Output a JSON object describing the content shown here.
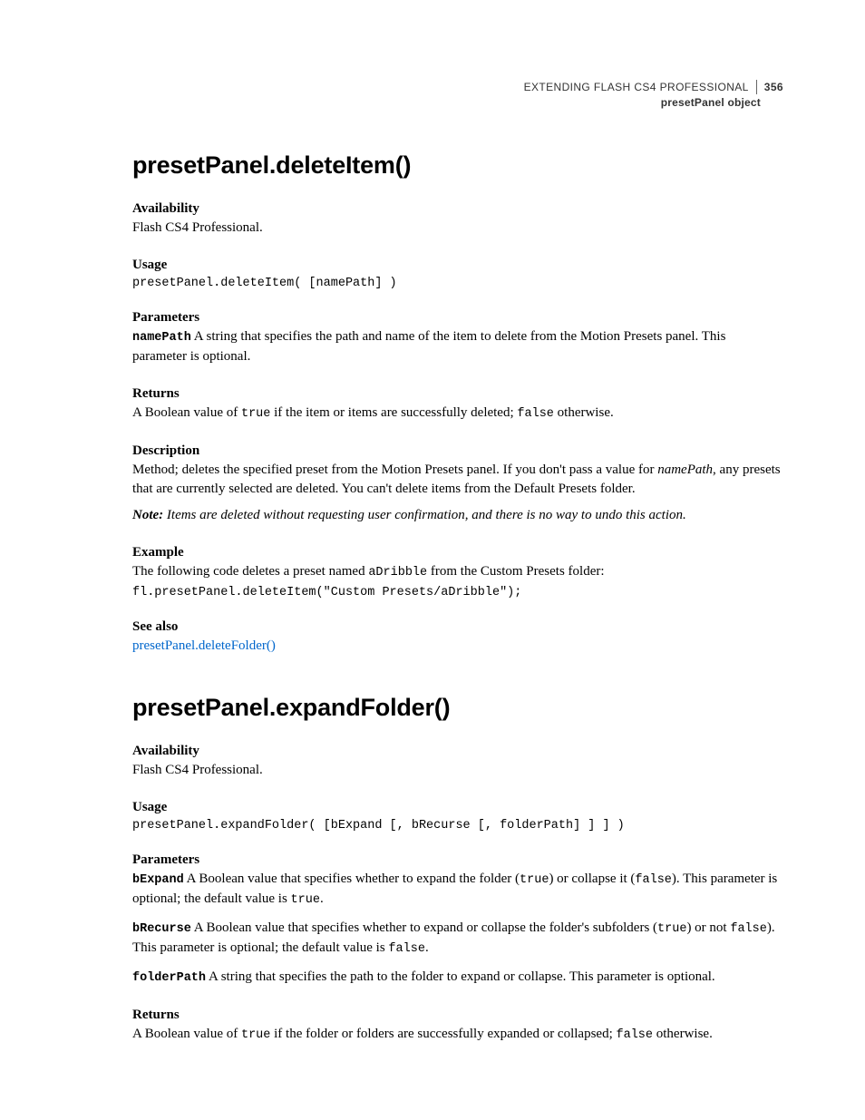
{
  "header": {
    "title": "EXTENDING FLASH CS4 PROFESSIONAL",
    "page_number": "356",
    "subtitle": "presetPanel object"
  },
  "method1": {
    "heading": "presetPanel.deleteItem()",
    "availability_label": "Availability",
    "availability_text": "Flash CS4 Professional.",
    "usage_label": "Usage",
    "usage_code": "presetPanel.deleteItem( [namePath] )",
    "parameters_label": "Parameters",
    "param_name": "namePath",
    "param_desc": "  A string that specifies the path and name of the item to delete from the Motion Presets panel. This parameter is optional.",
    "returns_label": "Returns",
    "returns_pre": "A Boolean value of ",
    "returns_code1": "true",
    "returns_mid": " if the item or items are successfully deleted; ",
    "returns_code2": "false",
    "returns_post": " otherwise.",
    "description_label": "Description",
    "description_pre": "Method; deletes the specified preset from the Motion Presets panel. If you don't pass a value for ",
    "description_em": "namePath",
    "description_post": ", any presets that are currently selected are deleted. You can't delete items from the Default Presets folder.",
    "note_label": "Note:",
    "note_text": " Items are deleted without requesting user confirmation, and there is no way to undo this action.",
    "example_label": "Example",
    "example_pre": "The following code deletes a preset named ",
    "example_code_inline": "aDribble",
    "example_post": " from the Custom Presets folder:",
    "example_code": "fl.presetPanel.deleteItem(\"Custom Presets/aDribble\");",
    "seealso_label": "See also",
    "seealso_link": "presetPanel.deleteFolder()"
  },
  "method2": {
    "heading": "presetPanel.expandFolder()",
    "availability_label": "Availability",
    "availability_text": "Flash CS4 Professional.",
    "usage_label": "Usage",
    "usage_code": "presetPanel.expandFolder( [bExpand [, bRecurse [, folderPath] ] ] )",
    "parameters_label": "Parameters",
    "p1_name": "bExpand",
    "p1_pre": "  A Boolean value that specifies whether to expand the folder (",
    "p1_c1": "true",
    "p1_mid": ") or collapse it (",
    "p1_c2": "false",
    "p1_post1": "). This parameter is optional; the default value is ",
    "p1_c3": "true",
    "p1_post2": ".",
    "p2_name": "bRecurse",
    "p2_pre": "  A Boolean value that specifies whether to expand or collapse the folder's subfolders (",
    "p2_c1": "true",
    "p2_mid": ") or not ",
    "p2_c2": "false",
    "p2_post1": "). This parameter is optional; the default value is ",
    "p2_c3": "false",
    "p2_post2": ".",
    "p3_name": "folderPath",
    "p3_text": "  A string that specifies the path to the folder to expand or collapse. This parameter is optional.",
    "returns_label": "Returns",
    "returns_pre": "A Boolean value of ",
    "returns_c1": "true",
    "returns_mid": " if the folder or folders are successfully expanded or collapsed; ",
    "returns_c2": "false",
    "returns_post": " otherwise."
  }
}
